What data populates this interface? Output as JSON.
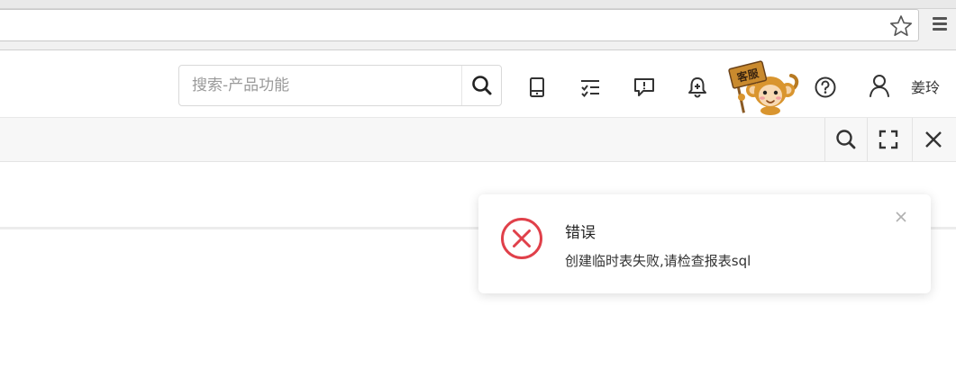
{
  "header": {
    "search": {
      "placeholder": "搜索-产品功能"
    },
    "customer_service_badge": "客服",
    "user_name": "姜玲"
  },
  "icons": {
    "browser": [
      "star-icon",
      "menu-icon"
    ],
    "header": [
      "search-icon",
      "tablet-icon",
      "checklist-icon",
      "message-icon",
      "bell-icon",
      "customer-service-mascot",
      "help-icon",
      "user-icon"
    ],
    "toolbar": [
      "search-icon",
      "fullscreen-icon",
      "close-icon"
    ]
  },
  "notification": {
    "type": "error",
    "title": "错误",
    "message": "创建临时表失败,请检查报表sql"
  },
  "colors": {
    "error": "#e0404a",
    "icon": "#333333",
    "mascot": "#c98a2e"
  }
}
